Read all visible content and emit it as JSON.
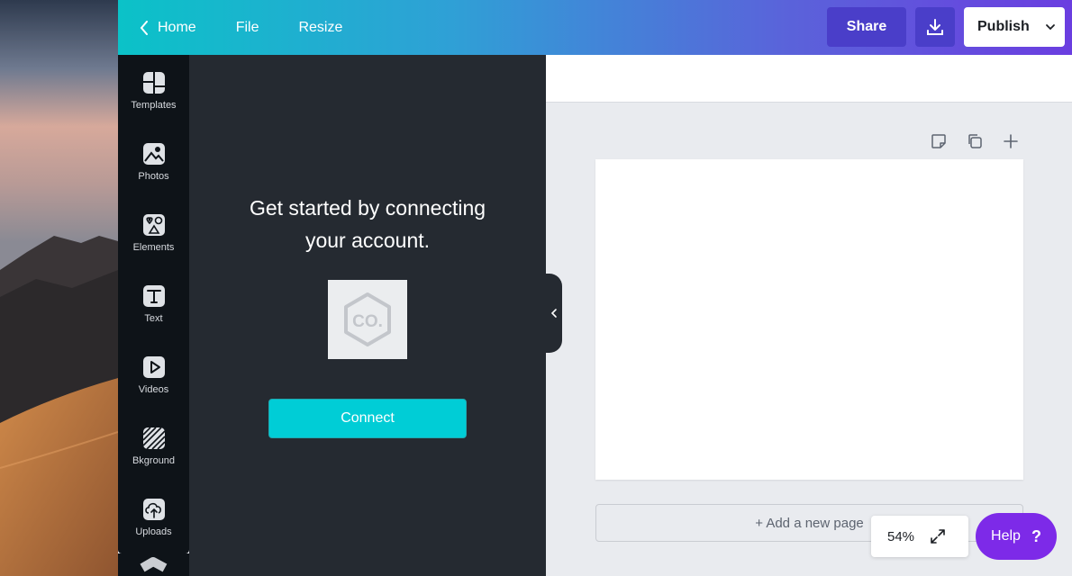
{
  "topbar": {
    "home_label": "Home",
    "file_label": "File",
    "resize_label": "Resize",
    "share_label": "Share",
    "publish_label": "Publish"
  },
  "rail": {
    "items": [
      {
        "label": "Templates",
        "icon": "templates-icon"
      },
      {
        "label": "Photos",
        "icon": "photos-icon"
      },
      {
        "label": "Elements",
        "icon": "elements-icon"
      },
      {
        "label": "Text",
        "icon": "text-icon"
      },
      {
        "label": "Videos",
        "icon": "videos-icon"
      },
      {
        "label": "Bkground",
        "icon": "background-icon"
      },
      {
        "label": "Uploads",
        "icon": "uploads-icon"
      }
    ]
  },
  "panel": {
    "message_line1": "Get started by connecting",
    "message_line2": "your account.",
    "logo_text": "CO.",
    "connect_label": "Connect"
  },
  "canvas": {
    "add_page_label": "+ Add a new page",
    "zoom_level": "54%"
  },
  "help": {
    "label": "Help",
    "glyph": "?"
  },
  "colors": {
    "accent_teal": "#00cdd6",
    "help_purple": "#7d2ae8",
    "share_blue": "#4a3ec9"
  }
}
